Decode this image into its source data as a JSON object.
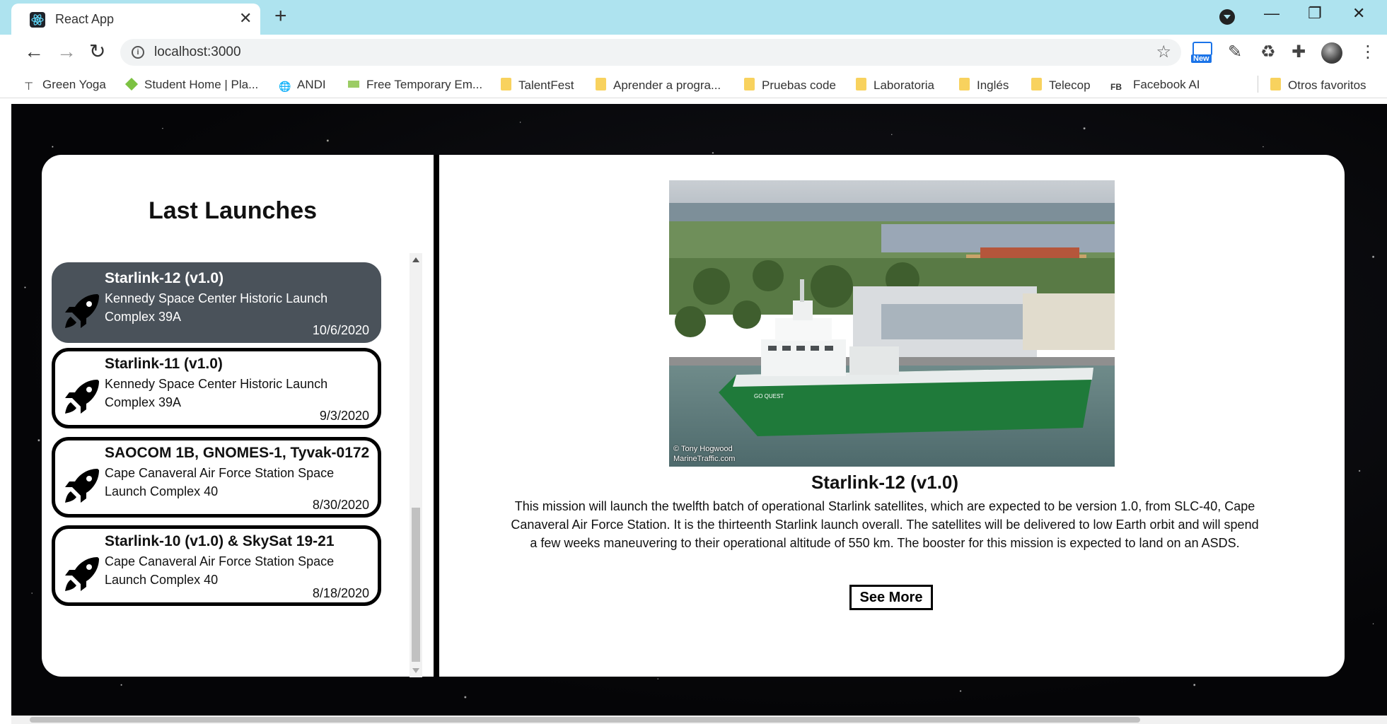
{
  "browser": {
    "tab_title": "React App",
    "url": "localhost:3000",
    "bookmarks": [
      {
        "label": "Green Yoga",
        "icon": "yoga-icon"
      },
      {
        "label": "Student Home | Pla...",
        "icon": "diamond-icon"
      },
      {
        "label": "ANDI",
        "icon": "globe-icon"
      },
      {
        "label": "Free Temporary Em...",
        "icon": "mail-icon"
      },
      {
        "label": "TalentFest",
        "icon": "folder-icon"
      },
      {
        "label": "Aprender a progra...",
        "icon": "folder-icon"
      },
      {
        "label": "Pruebas code",
        "icon": "folder-icon"
      },
      {
        "label": "Laboratoria",
        "icon": "folder-icon"
      },
      {
        "label": "Inglés",
        "icon": "folder-icon"
      },
      {
        "label": "Telecop",
        "icon": "folder-icon"
      },
      {
        "label": "Facebook AI",
        "icon": "fb-icon",
        "badge": "FB"
      }
    ],
    "other_bookmarks": "Otros favoritos",
    "extension_badge": "New"
  },
  "launches": {
    "title": "Last Launches",
    "items": [
      {
        "name": "Starlink-12 (v1.0)",
        "site": "Kennedy Space Center Historic Launch Complex 39A",
        "date": "10/6/2020",
        "active": true
      },
      {
        "name": "Starlink-11 (v1.0)",
        "site": "Kennedy Space Center Historic Launch Complex 39A",
        "date": "9/3/2020",
        "active": false
      },
      {
        "name": "SAOCOM 1B, GNOMES-1, Tyvak-0172",
        "site": "Cape Canaveral Air Force Station Space Launch Complex 40",
        "date": "8/30/2020",
        "active": false
      },
      {
        "name": "Starlink-10 (v1.0) & SkySat 19-21",
        "site": "Cape Canaveral Air Force Station Space Launch Complex 40",
        "date": "8/18/2020",
        "active": false
      }
    ]
  },
  "detail": {
    "name": "Starlink-12 (v1.0)",
    "description": "This mission will launch the twelfth batch of operational Starlink satellites, which are expected to be version 1.0, from SLC-40, Cape Canaveral Air Force Station. It is the thirteenth Starlink launch overall. The satellites will be delivered to low Earth orbit and will spend a few weeks maneuvering to their operational altitude of 550 km. The booster for this mission is expected to land on an ASDS.",
    "button": "See More",
    "photo": {
      "ship_name": "GO QUEST",
      "credit_line1": "© Tony Hogwood",
      "credit_line2": "MarineTraffic.com"
    }
  },
  "colors": {
    "chrome_tab_strip": "#aee3ef",
    "active_card": "#4a525a",
    "folder": "#f8d25e",
    "ship_hull": "#1f7a3a"
  }
}
